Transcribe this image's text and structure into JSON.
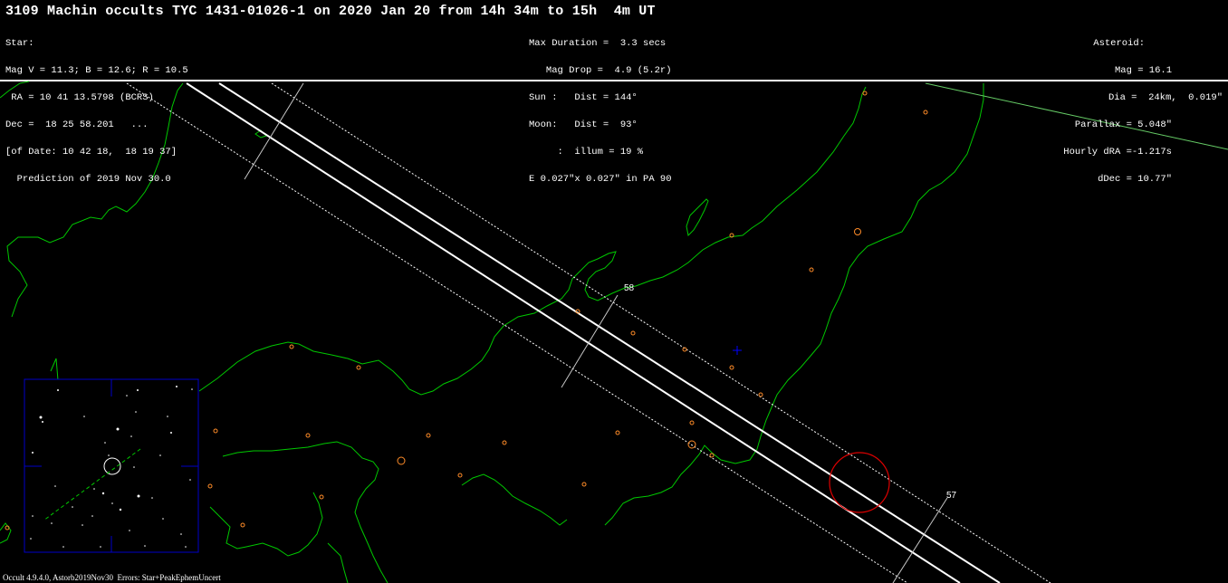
{
  "title": "3109 Machin occults TYC 1431-01026-1 on 2020 Jan 20 from 14h 34m to 15h  4m UT",
  "star": {
    "heading": "Star:",
    "mags": "Mag V = 11.3; B = 12.6; R = 10.5",
    "ra": " RA = 10 41 13.5798 (BCRS)",
    "dec": "Dec =  18 25 58.201   ...",
    "of_date": "[of Date: 10 42 18,  18 19 37]",
    "prediction": "  Prediction of 2019 Nov 30.0"
  },
  "event": {
    "max_duration": "Max Duration =  3.3 secs",
    "mag_drop": "   Mag Drop =  4.9 (5.2r)",
    "sun": "Sun :   Dist = 144°",
    "moon": "Moon:   Dist =  93°",
    "illum": "     :  illum = 19 %",
    "ellipse": "E 0.027\"x 0.027\" in PA 90"
  },
  "asteroid": {
    "heading": "Asteroid:",
    "mag": "Mag = 16.1",
    "dia": "Dia =  24km,  0.019\"",
    "parallax": "Parallax = 5.048\"",
    "hourly_dra": "Hourly dRA =-1.217s",
    "ddec": "dDec = 10.77\""
  },
  "map": {
    "time_labels": [
      "58",
      "57"
    ],
    "colors": {
      "coastline": "#00c800",
      "path": "#ffffff",
      "sites": "#ff8c28",
      "uncertainty_circle": "#dc0000",
      "star_chart_frame": "#0000c8",
      "center_marker": "#0000ff",
      "horizon_line": "#66cc66",
      "time_tick": "#c8c8c8"
    },
    "star_chart": {
      "frame_icon": "star-chart-frame"
    }
  },
  "footer": "Occult 4.9.4.0, Astorb2019Nov30  Errors: Star+PeakEphemUncert"
}
